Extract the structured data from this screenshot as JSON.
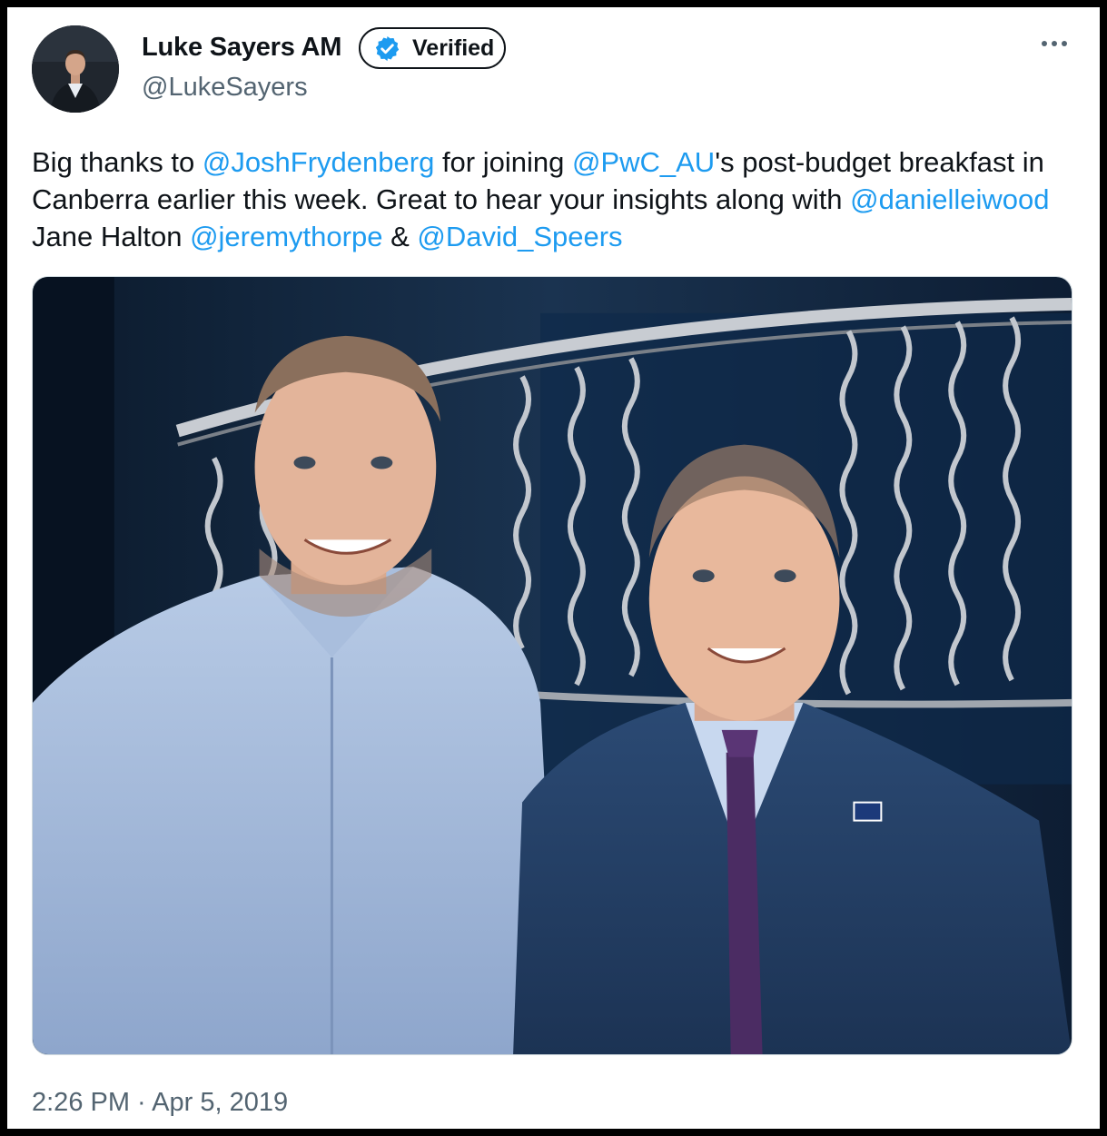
{
  "tweet": {
    "author": {
      "name": "Luke Sayers AM",
      "handle": "@LukeSayers",
      "verified_label": "Verified",
      "verified_icon": "verified-badge-icon",
      "more_icon": "more-options-icon"
    },
    "text_segments": {
      "t1": "Big thanks to ",
      "m1": "@JoshFrydenberg",
      "t2": " for joining ",
      "m2": "@PwC_AU",
      "t3": "'s post-budget breakfast in Canberra earlier this week. Great to hear your insights along with ",
      "m3": "@danielleiwood",
      "t4": " Jane Halton ",
      "m4": "@jeremythorpe",
      "t5": " & ",
      "m5": "@David_Speers"
    },
    "timestamp": "2:26 PM · Apr 5, 2019"
  },
  "colors": {
    "text": "#0f1419",
    "secondary": "#536471",
    "link": "#1d9bf0"
  }
}
